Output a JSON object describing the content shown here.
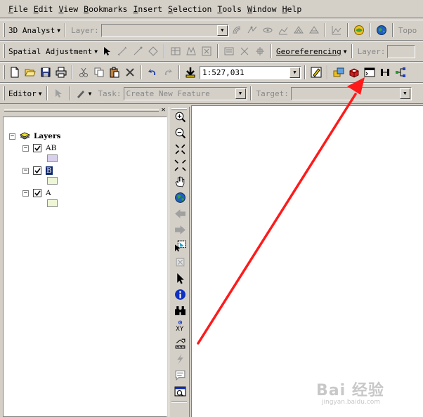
{
  "menu": {
    "items": [
      {
        "key": "F",
        "rest": "ile"
      },
      {
        "key": "E",
        "rest": "dit"
      },
      {
        "key": "V",
        "rest": "iew"
      },
      {
        "key": "B",
        "rest": "ookmarks"
      },
      {
        "key": "I",
        "rest": "nsert"
      },
      {
        "key": "S",
        "rest": "election"
      },
      {
        "key": "T",
        "rest": "ools"
      },
      {
        "key": "W",
        "rest": "indow"
      },
      {
        "key": "H",
        "rest": "elp"
      }
    ]
  },
  "toolbar_3d": {
    "analyst_label": "3D Analyst",
    "layer_label": "Layer:",
    "layer_value": "",
    "topo_label": "Topo"
  },
  "toolbar_spatial": {
    "spatial_label": "Spatial Adjustment",
    "georef_label": "Georeferencing",
    "layer_label": "Layer:",
    "layer_value": ""
  },
  "toolbar_standard": {
    "scale_value": "1:527,031"
  },
  "toolbar_editor": {
    "editor_label": "Editor",
    "task_label": "Task:",
    "task_value": "Create New Feature",
    "target_label": "Target:",
    "target_value": ""
  },
  "toc": {
    "root_label": "Layers",
    "layers": [
      {
        "name": "AB",
        "checked": true,
        "selected": false,
        "swatch": "#d8d0ec"
      },
      {
        "name": "B",
        "checked": true,
        "selected": true,
        "swatch": "#eef6d8"
      },
      {
        "name": "A",
        "checked": true,
        "selected": false,
        "swatch": "#eef6d8"
      }
    ]
  },
  "colors": {
    "annotation_arrow": "#ff1a1a",
    "selection": "#0a246a",
    "chrome": "#d4d0c8"
  },
  "watermark": {
    "main": "Bai 经验",
    "sub": "jingyan.baidu.com"
  }
}
